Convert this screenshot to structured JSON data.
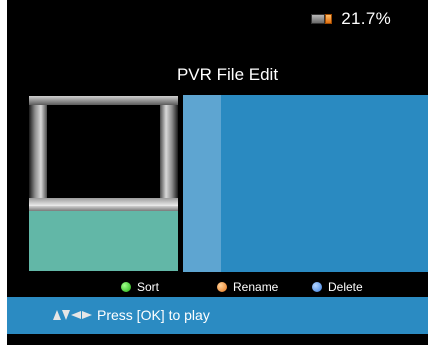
{
  "storage": {
    "usage": "21.7%",
    "icon": "hdd-battery-icon"
  },
  "title": "PVR File Edit",
  "preview": {
    "frame_icon": "tv-icon"
  },
  "legend": [
    {
      "label": "Sort",
      "color": "#1fae12",
      "icon": "green-button-icon"
    },
    {
      "label": "Rename",
      "color": "#e8761a",
      "icon": "orange-button-icon"
    },
    {
      "label": "Delete",
      "color": "#3b7fe0",
      "icon": "blue-button-icon"
    }
  ],
  "hint": {
    "text": "Press [OK] to play",
    "icon": "navigation-arrows-icon"
  }
}
